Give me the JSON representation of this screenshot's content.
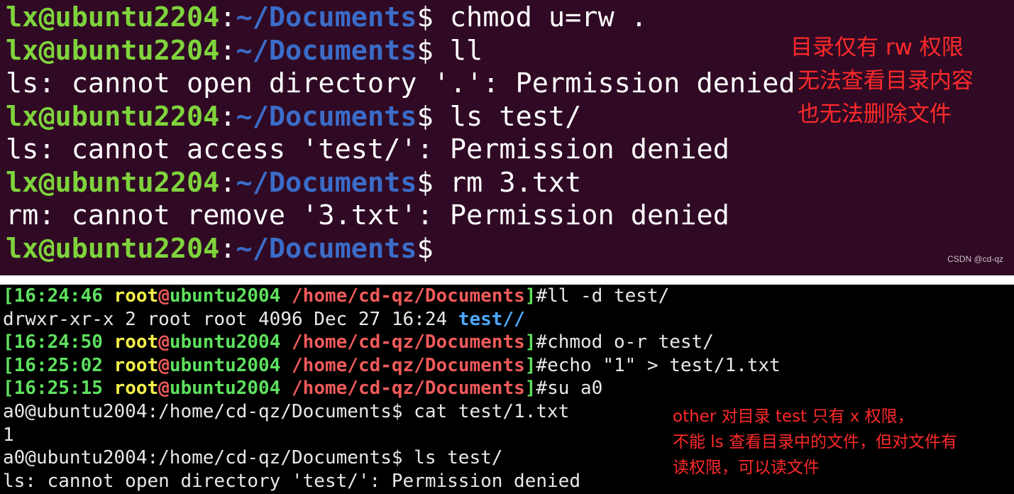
{
  "terminal_top": {
    "background": "#300a24",
    "prompt": {
      "user_host": "lx@ubuntu2204",
      "sep": ":",
      "path": "~/Documents",
      "symbol": "$"
    },
    "lines": [
      {
        "type": "prompt",
        "cmd": " chmod u=rw ."
      },
      {
        "type": "prompt",
        "cmd": " ll"
      },
      {
        "type": "output",
        "text": "ls: cannot open directory '.': Permission denied"
      },
      {
        "type": "prompt",
        "cmd": " ls test/"
      },
      {
        "type": "output",
        "text": "ls: cannot access 'test/': Permission denied"
      },
      {
        "type": "prompt",
        "cmd": " rm 3.txt"
      },
      {
        "type": "output",
        "text": "rm: cannot remove '3.txt': Permission denied"
      },
      {
        "type": "prompt",
        "cmd": ""
      }
    ],
    "annotation": [
      "目录仅有 rw 权限",
      " 无法查看目录内容",
      " 也无法删除文件"
    ],
    "watermark": "CSDN @cd-qz"
  },
  "terminal_bottom": {
    "background": "#000000",
    "root_prompt": {
      "lb": "[",
      "user": "root",
      "at": "@",
      "host": "ubuntu2004",
      "path": " /home/cd-qz/Documents",
      "rb": "]",
      "symbol": "#"
    },
    "lines": [
      {
        "type": "root",
        "time": "16:24:46",
        "cmd": "ll -d test/"
      },
      {
        "type": "dirlist",
        "pre": "drwxr-xr-x 2 root root 4096 Dec 27 16:24 ",
        "name": "test/",
        "post": "/"
      },
      {
        "type": "root",
        "time": "16:24:50",
        "cmd": "chmod o-r test/"
      },
      {
        "type": "root",
        "time": "16:25:02",
        "cmd": "echo \"1\" > test/1.txt"
      },
      {
        "type": "root",
        "time": "16:25:15",
        "cmd": "su a0"
      },
      {
        "type": "plain",
        "text": "a0@ubuntu2004:/home/cd-qz/Documents$ cat test/1.txt"
      },
      {
        "type": "plain",
        "text": "1"
      },
      {
        "type": "plain",
        "text": "a0@ubuntu2004:/home/cd-qz/Documents$ ls test/"
      },
      {
        "type": "plain",
        "text": "ls: cannot open directory 'test/': Permission denied"
      }
    ],
    "annotation": [
      "other 对目录 test 只有 x 权限，",
      "不能 ls 查看目录中的文件，但对文件有",
      "读权限，可以读文件"
    ]
  }
}
